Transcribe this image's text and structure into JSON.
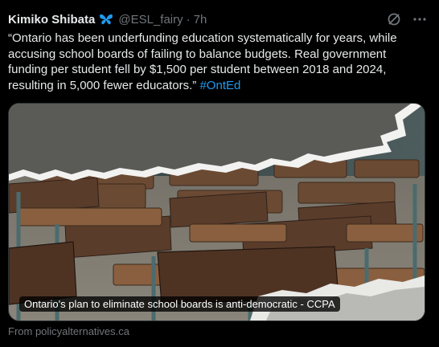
{
  "tweet": {
    "author_name": "Kimiko Shibata",
    "author_handle": "@ESL_fairy",
    "separator": "·",
    "time": "7h",
    "text": "“Ontario has been underfunding education systematically for years, while accusing school boards of failing to balance budgets. Real government funding per student fell by $1,500 per student between 2018 and 2024, resulting in 5,000 fewer educators.” ",
    "hashtag": "#OntEd",
    "icons": {
      "badge": "butterfly-icon",
      "grok": "grok-icon",
      "more": "more-icon"
    }
  },
  "card": {
    "caption": "Ontario's plan to eliminate school boards is anti-democratic - CCPA",
    "source": "From policyalternatives.ca"
  },
  "colors": {
    "background": "#000000",
    "text": "#e7e9ea",
    "muted": "#71767b",
    "link": "#1d9bf0",
    "butterfly": "#1d9bf0"
  }
}
